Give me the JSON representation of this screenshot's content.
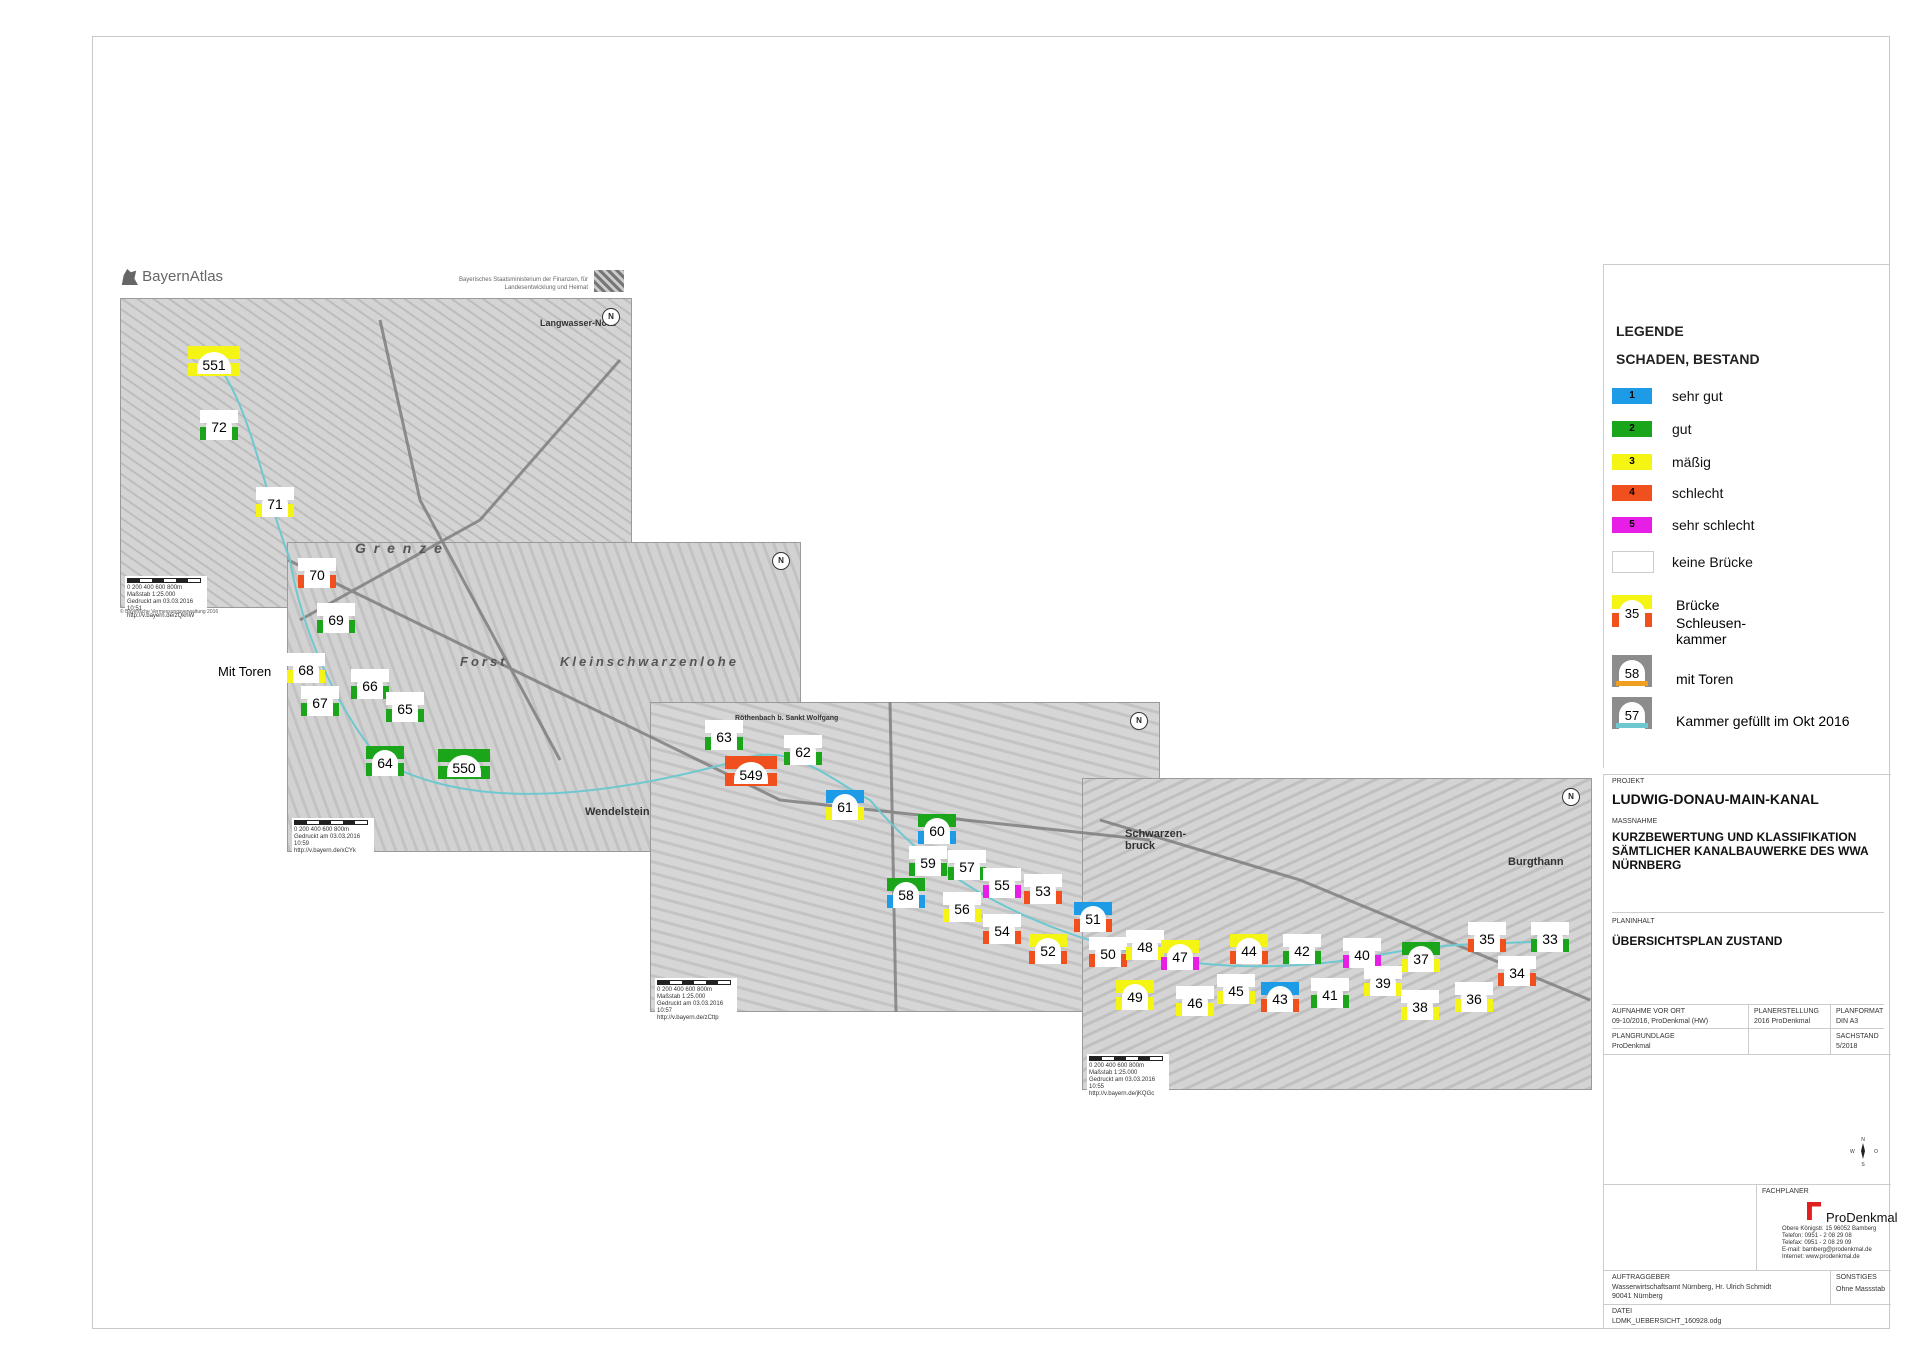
{
  "header": {
    "bayern_atlas": "BayernAtlas",
    "ministry": "Bayerisches Staatsministerium der Finanzen, für Landesentwicklung und Heimat",
    "copyright": "© Bayerische Vermessungsverwaltung 2016"
  },
  "map": {
    "places": {
      "langwasser": "Langwasser-Nord",
      "wendelstein": "Wendelstein",
      "schwarzenbruck": "Schwarzen-bruck",
      "burgthann": "Burgthann",
      "forst": "Forst",
      "kleinschwarzenlohe": "Kleinschwarzenlohe",
      "grenze": "G r e n z e",
      "rothenbach": "Röthenbach b. Sankt Wolfgang"
    },
    "annotation_mit_toren": "Mit Toren",
    "north_label": "N",
    "scales": [
      {
        "ticks": "0 200 400 600 800m",
        "mass": "Maßstab 1:25.000",
        "gedruckt": "Gedruckt am 03.03.2016 10:51",
        "url": "http://v.bayern.de/zQkhW"
      },
      {
        "ticks": "0 200 400 600 800m",
        "mass": "",
        "gedruckt": "Gedruckt am 03.03.2016 10:59",
        "url": "http://v.bayern.de/xCYk"
      },
      {
        "ticks": "0 200 400 600 800m",
        "mass": "Maßstab 1:25.000",
        "gedruckt": "Gedruckt am 03.03.2016 10:57",
        "url": "http://v.bayern.de/zCttp"
      },
      {
        "ticks": "0 200 400 600 800m",
        "mass": "Maßstab 1:25.000",
        "gedruckt": "Gedruckt am 03.03.2016 10:55",
        "url": "http://v.bayern.de/jKQGc"
      }
    ],
    "markers": [
      {
        "id": "551",
        "top": "yellow",
        "bot": "yellow"
      },
      {
        "id": "72",
        "top": "white",
        "bot": "green"
      },
      {
        "id": "71",
        "top": "white",
        "bot": "yellow"
      },
      {
        "id": "70",
        "top": "white",
        "bot": "orange"
      },
      {
        "id": "69",
        "top": "white",
        "bot": "green"
      },
      {
        "id": "68",
        "top": "white",
        "bot": "yellow"
      },
      {
        "id": "67",
        "top": "white",
        "bot": "green"
      },
      {
        "id": "66",
        "top": "white",
        "bot": "green"
      },
      {
        "id": "65",
        "top": "white",
        "bot": "green"
      },
      {
        "id": "64",
        "top": "green",
        "bot": "green"
      },
      {
        "id": "550",
        "top": "green",
        "bot": "green"
      },
      {
        "id": "63",
        "top": "white",
        "bot": "green"
      },
      {
        "id": "62",
        "top": "white",
        "bot": "green"
      },
      {
        "id": "549",
        "top": "orange",
        "bot": "orange"
      },
      {
        "id": "61",
        "top": "blue",
        "bot": "yellow"
      },
      {
        "id": "60",
        "top": "green",
        "bot": "blue"
      },
      {
        "id": "59",
        "top": "white",
        "bot": "green"
      },
      {
        "id": "57",
        "top": "white",
        "bot": "green"
      },
      {
        "id": "58",
        "top": "green",
        "bot": "blue"
      },
      {
        "id": "56",
        "top": "white",
        "bot": "yellow"
      },
      {
        "id": "55",
        "top": "white",
        "bot": "magenta"
      },
      {
        "id": "54",
        "top": "white",
        "bot": "orange"
      },
      {
        "id": "53",
        "top": "white",
        "bot": "orange"
      },
      {
        "id": "52",
        "top": "yellow",
        "bot": "orange"
      },
      {
        "id": "51",
        "top": "blue",
        "bot": "orange"
      },
      {
        "id": "50",
        "top": "white",
        "bot": "orange"
      },
      {
        "id": "49",
        "top": "yellow",
        "bot": "yellow"
      },
      {
        "id": "48",
        "top": "white",
        "bot": "yellow"
      },
      {
        "id": "47",
        "top": "yellow",
        "bot": "magenta"
      },
      {
        "id": "46",
        "top": "white",
        "bot": "yellow"
      },
      {
        "id": "45",
        "top": "white",
        "bot": "yellow"
      },
      {
        "id": "44",
        "top": "yellow",
        "bot": "orange"
      },
      {
        "id": "43",
        "top": "blue",
        "bot": "orange"
      },
      {
        "id": "42",
        "top": "white",
        "bot": "green"
      },
      {
        "id": "41",
        "top": "white",
        "bot": "green"
      },
      {
        "id": "40",
        "top": "white",
        "bot": "magenta"
      },
      {
        "id": "39",
        "top": "white",
        "bot": "yellow"
      },
      {
        "id": "38",
        "top": "white",
        "bot": "yellow"
      },
      {
        "id": "37",
        "top": "green",
        "bot": "yellow"
      },
      {
        "id": "36",
        "top": "white",
        "bot": "yellow"
      },
      {
        "id": "35",
        "top": "white",
        "bot": "orange"
      },
      {
        "id": "34",
        "top": "white",
        "bot": "orange"
      },
      {
        "id": "33",
        "top": "white",
        "bot": "green"
      }
    ]
  },
  "legend": {
    "title": "LEGENDE",
    "subtitle": "SCHADEN, BESTAND",
    "classes": [
      {
        "num": "1",
        "label": "sehr gut",
        "color": "#1e9be6"
      },
      {
        "num": "2",
        "label": "gut",
        "color": "#1aa51a"
      },
      {
        "num": "3",
        "label": "mäßig",
        "color": "#f5f514"
      },
      {
        "num": "4",
        "label": "schlecht",
        "color": "#f0501e"
      },
      {
        "num": "5",
        "label": "sehr schlecht",
        "color": "#e61ee6"
      },
      {
        "num": "",
        "label": "keine Brücke",
        "color": "#ffffff"
      }
    ],
    "bruecke": "Brücke",
    "schleusen": "Schleusen-kammer",
    "sample35": "35",
    "sample58": "58",
    "mit_toren": "mit Toren",
    "sample57": "57",
    "gefuellt": "Kammer gefüllt im Okt 2016"
  },
  "titleblock": {
    "projekt_label": "PROJEKT",
    "projekt": "LUDWIG-DONAU-MAIN-KANAL",
    "massnahme_label": "MASSNAHME",
    "massnahme": "KURZBEWERTUNG UND KLASSIFIKATION SÄMTLICHER KANALBAUWERKE DES WWA NÜRNBERG",
    "planinhalt_label": "PLANINHALT",
    "planinhalt": "ÜBERSICHTSPLAN ZUSTAND",
    "aufnahme_label": "AUFNAHME VOR ORT",
    "aufnahme": "09-10/2016, ProDenkmal (HW)",
    "planerstellung_label": "PLANERSTELLUNG",
    "planerstellung": "2016 ProDenkmal",
    "planformat_label": "PLANFORMAT",
    "planformat": "DIN A3",
    "plangrundlage_label": "PLANGRUNDLAGE",
    "plangrundlage": "ProDenkmal",
    "sachstand_label": "SACHSTAND",
    "sachstand": "5/2018",
    "fachplaner_label": "FACHPLANER",
    "fachplaner": "ProDenkmal",
    "fp_address": "Obere Königstr. 15   96052 Bamberg",
    "fp_tel": "Telefon:        0951 - 2 08 29 08",
    "fp_fax": "Telefax:        0951 - 2 08 29 09",
    "fp_email": "E-mail:    bamberg@prodenkmal.de",
    "fp_web": "Internet:        www.prodenkmal.de",
    "auftraggeber_label": "AUFTRAGGEBER",
    "auftraggeber": "Wasserwirtschaftsamt Nürnberg, Hr. Ulrich Schmidt",
    "auftraggeber_ort": "90041 Nürnberg",
    "sonstiges_label": "SONSTIGES",
    "sonstiges": "Ohne Massstab",
    "datei_label": "DATEI",
    "datei": "LDMK_UEBERSICHT_160928.odg"
  },
  "colors": {
    "blue": "#1e9be6",
    "green": "#1aa51a",
    "yellow": "#f5f514",
    "orange": "#f0501e",
    "magenta": "#e61ee6",
    "white": "#ffffff",
    "canal": "#6fc8d0",
    "map_bg": "#c9c9c9"
  }
}
